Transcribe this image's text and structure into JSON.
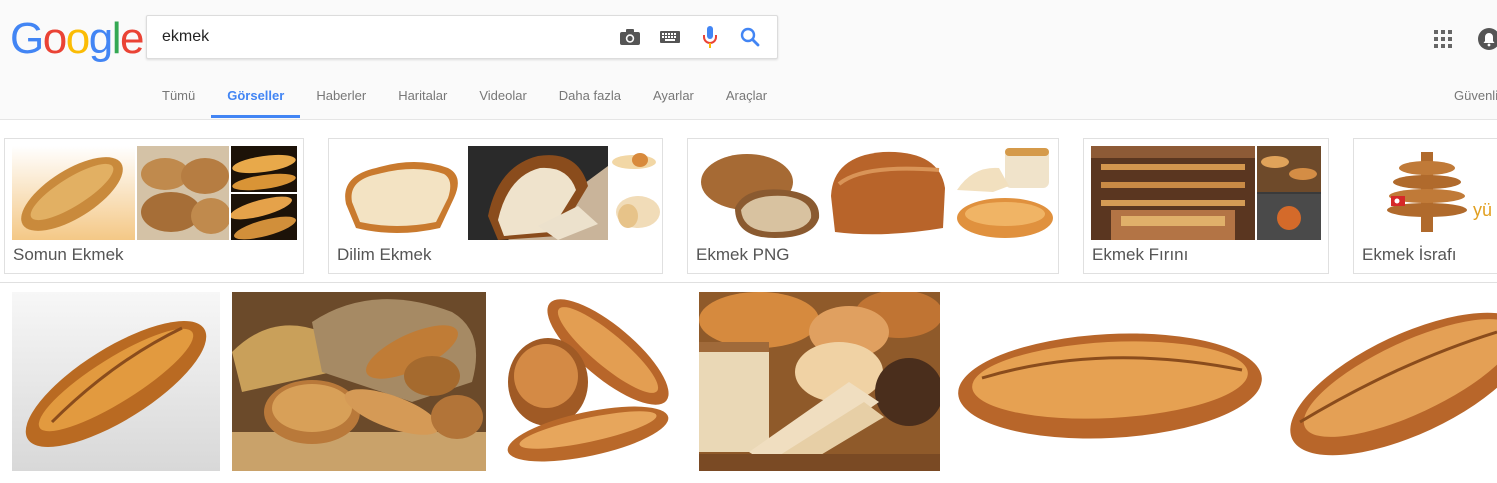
{
  "logo": {
    "letters": [
      "G",
      "o",
      "o",
      "g",
      "l",
      "e"
    ],
    "colors": [
      "#4285f4",
      "#ea4335",
      "#fbbc05",
      "#4285f4",
      "#34a853",
      "#ea4335"
    ]
  },
  "search": {
    "query": "ekmek"
  },
  "icons": {
    "camera": "camera-icon",
    "keyboard": "keyboard-icon",
    "mic": "mic-icon",
    "search": "search-icon",
    "apps": "apps-grid-icon",
    "notifications": "notifications-icon"
  },
  "tabs": [
    {
      "label": "Tümü"
    },
    {
      "label": "Görseller",
      "active": true
    },
    {
      "label": "Haberler"
    },
    {
      "label": "Haritalar"
    },
    {
      "label": "Videolar"
    },
    {
      "label": "Daha fazla"
    },
    {
      "label": "Ayarlar"
    },
    {
      "label": "Araçlar"
    }
  ],
  "safe_search": {
    "label": "Güvenli"
  },
  "related": [
    {
      "label": "Somun Ekmek"
    },
    {
      "label": "Dilim Ekmek"
    },
    {
      "label": "Ekmek PNG"
    },
    {
      "label": "Ekmek Fırını"
    },
    {
      "label": "Ekmek İsrafı",
      "partial_text": "yü"
    }
  ],
  "colors": {
    "accent": "#4285f4",
    "bread_crust": "#c97a2e",
    "bread_light": "#e9b46a",
    "bread_dark": "#8a4c1c",
    "crumb": "#f3e3c3"
  }
}
